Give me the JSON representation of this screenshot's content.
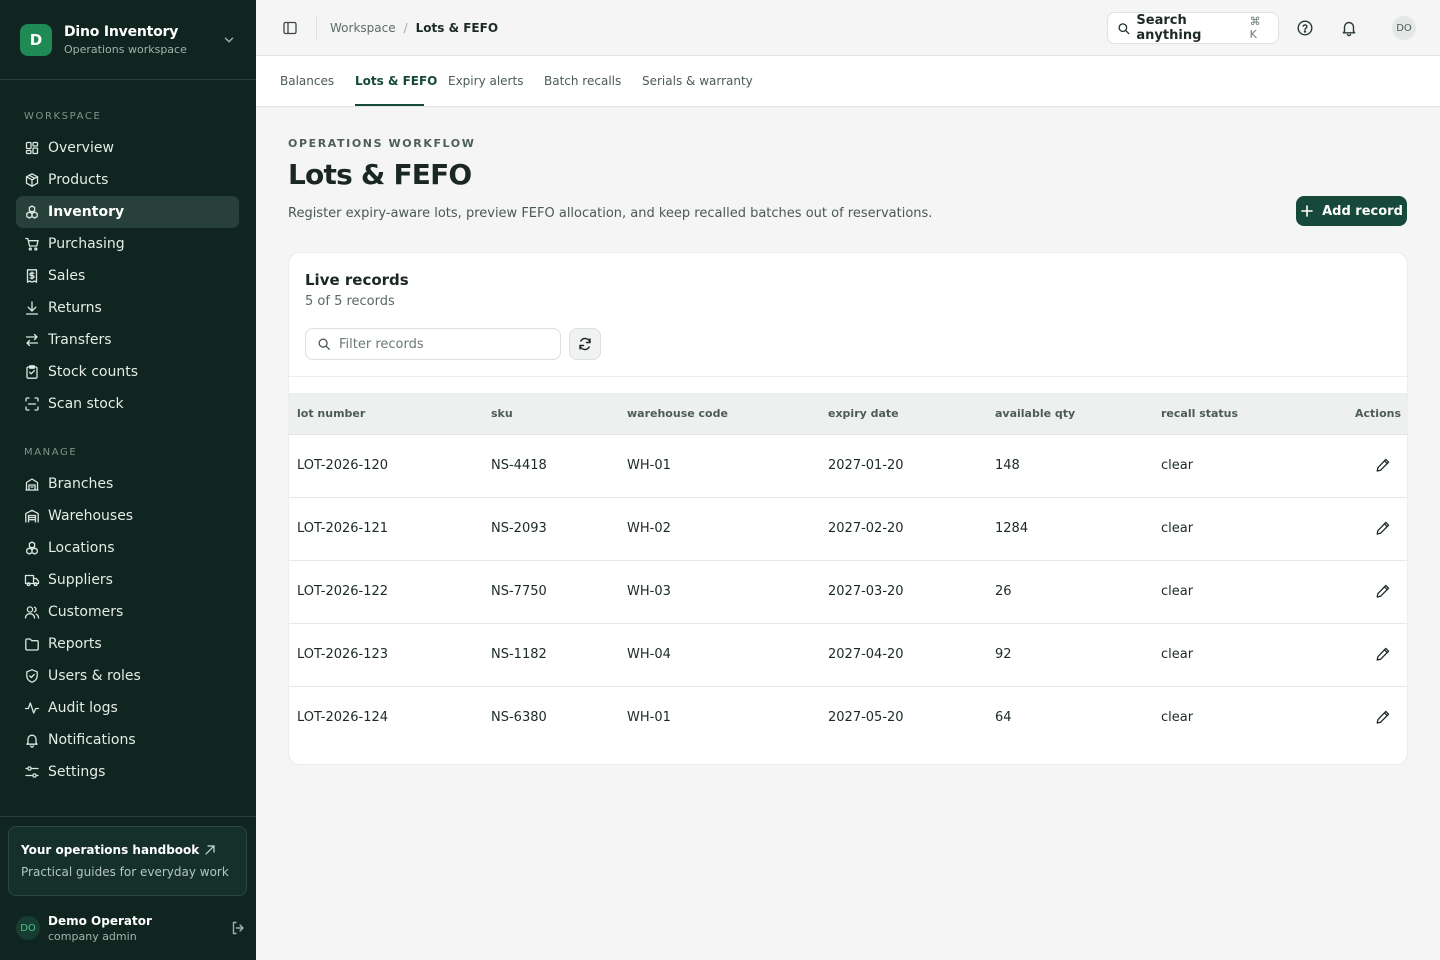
{
  "brand": {
    "initial": "D",
    "name": "Dino Inventory",
    "subtitle": "Operations workspace"
  },
  "sidebar": {
    "sections": [
      {
        "title": "WORKSPACE",
        "items": [
          {
            "label": "Overview",
            "icon": "dashboard-icon"
          },
          {
            "label": "Products",
            "icon": "package-icon"
          },
          {
            "label": "Inventory",
            "icon": "boxes-icon",
            "active": true
          },
          {
            "label": "Purchasing",
            "icon": "cart-icon"
          },
          {
            "label": "Sales",
            "icon": "receipt-icon"
          },
          {
            "label": "Returns",
            "icon": "arrow-down-icon"
          },
          {
            "label": "Transfers",
            "icon": "transfer-icon"
          },
          {
            "label": "Stock counts",
            "icon": "clipboard-icon"
          },
          {
            "label": "Scan stock",
            "icon": "scan-icon"
          }
        ]
      },
      {
        "title": "MANAGE",
        "items": [
          {
            "label": "Branches",
            "icon": "building-icon"
          },
          {
            "label": "Warehouses",
            "icon": "warehouse-icon"
          },
          {
            "label": "Locations",
            "icon": "boxes-icon"
          },
          {
            "label": "Suppliers",
            "icon": "truck-icon"
          },
          {
            "label": "Customers",
            "icon": "users-icon"
          },
          {
            "label": "Reports",
            "icon": "folder-icon"
          },
          {
            "label": "Users & roles",
            "icon": "shield-icon"
          },
          {
            "label": "Audit logs",
            "icon": "activity-icon"
          },
          {
            "label": "Notifications",
            "icon": "bell-icon"
          },
          {
            "label": "Settings",
            "icon": "sliders-icon"
          }
        ]
      }
    ],
    "handbook": {
      "title": "Your operations handbook",
      "subtitle": "Practical guides for everyday work"
    },
    "user": {
      "initials": "DO",
      "name": "Demo Operator",
      "role": "company admin"
    }
  },
  "topbar": {
    "breadcrumb": [
      "Workspace",
      "Lots & FEFO"
    ],
    "search_label": "Search anything",
    "shortcut": "⌘ K",
    "avatar": "DO"
  },
  "tabs": [
    {
      "label": "Balances"
    },
    {
      "label": "Lots & FEFO",
      "active": true
    },
    {
      "label": "Expiry alerts"
    },
    {
      "label": "Batch recalls"
    },
    {
      "label": "Serials & warranty"
    }
  ],
  "header": {
    "eyebrow": "OPERATIONS WORKFLOW",
    "title": "Lots & FEFO",
    "description": "Register expiry-aware lots, preview FEFO allocation, and keep recalled batches out of reservations.",
    "add_label": "Add record"
  },
  "records": {
    "title": "Live records",
    "count": "5 of 5 records",
    "filter_placeholder": "Filter records",
    "columns": [
      "lot number",
      "sku",
      "warehouse code",
      "expiry date",
      "available qty",
      "recall status",
      "Actions"
    ],
    "rows": [
      [
        "LOT-2026-120",
        "NS-4418",
        "WH-01",
        "2027-01-20",
        "148",
        "clear"
      ],
      [
        "LOT-2026-121",
        "NS-2093",
        "WH-02",
        "2027-02-20",
        "1284",
        "clear"
      ],
      [
        "LOT-2026-122",
        "NS-7750",
        "WH-03",
        "2027-03-20",
        "26",
        "clear"
      ],
      [
        "LOT-2026-123",
        "NS-1182",
        "WH-04",
        "2027-04-20",
        "92",
        "clear"
      ],
      [
        "LOT-2026-124",
        "NS-6380",
        "WH-01",
        "2027-05-20",
        "64",
        "clear"
      ]
    ]
  },
  "colors": {
    "sidebar_bg": "#102420",
    "accent": "#16493a",
    "brand_green": "#1f8a55"
  }
}
